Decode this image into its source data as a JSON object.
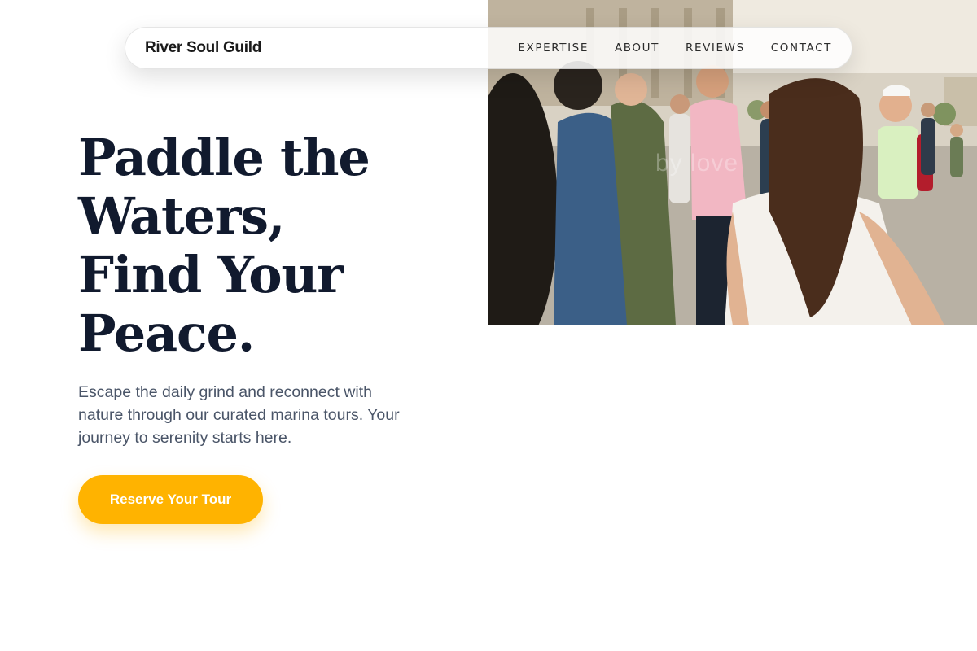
{
  "brand": {
    "name": "River Soul Guild"
  },
  "nav": {
    "links": [
      {
        "label": "EXPERTISE"
      },
      {
        "label": "ABOUT"
      },
      {
        "label": "REVIEWS"
      },
      {
        "label": "CONTACT"
      }
    ]
  },
  "hero": {
    "title_lines": [
      "Paddle the",
      "Waters,",
      "Find Your",
      "Peace."
    ],
    "subtitle": "Escape the daily grind and reconnect with nature through our curated marina tours. Your journey to serenity starts here.",
    "cta_label": "Reserve Your Tour",
    "photo_watermark": "by       love"
  },
  "colors": {
    "accent": "#ffb300",
    "title": "#111a2e",
    "body_text": "#4a5568",
    "background": "#ffffff"
  }
}
